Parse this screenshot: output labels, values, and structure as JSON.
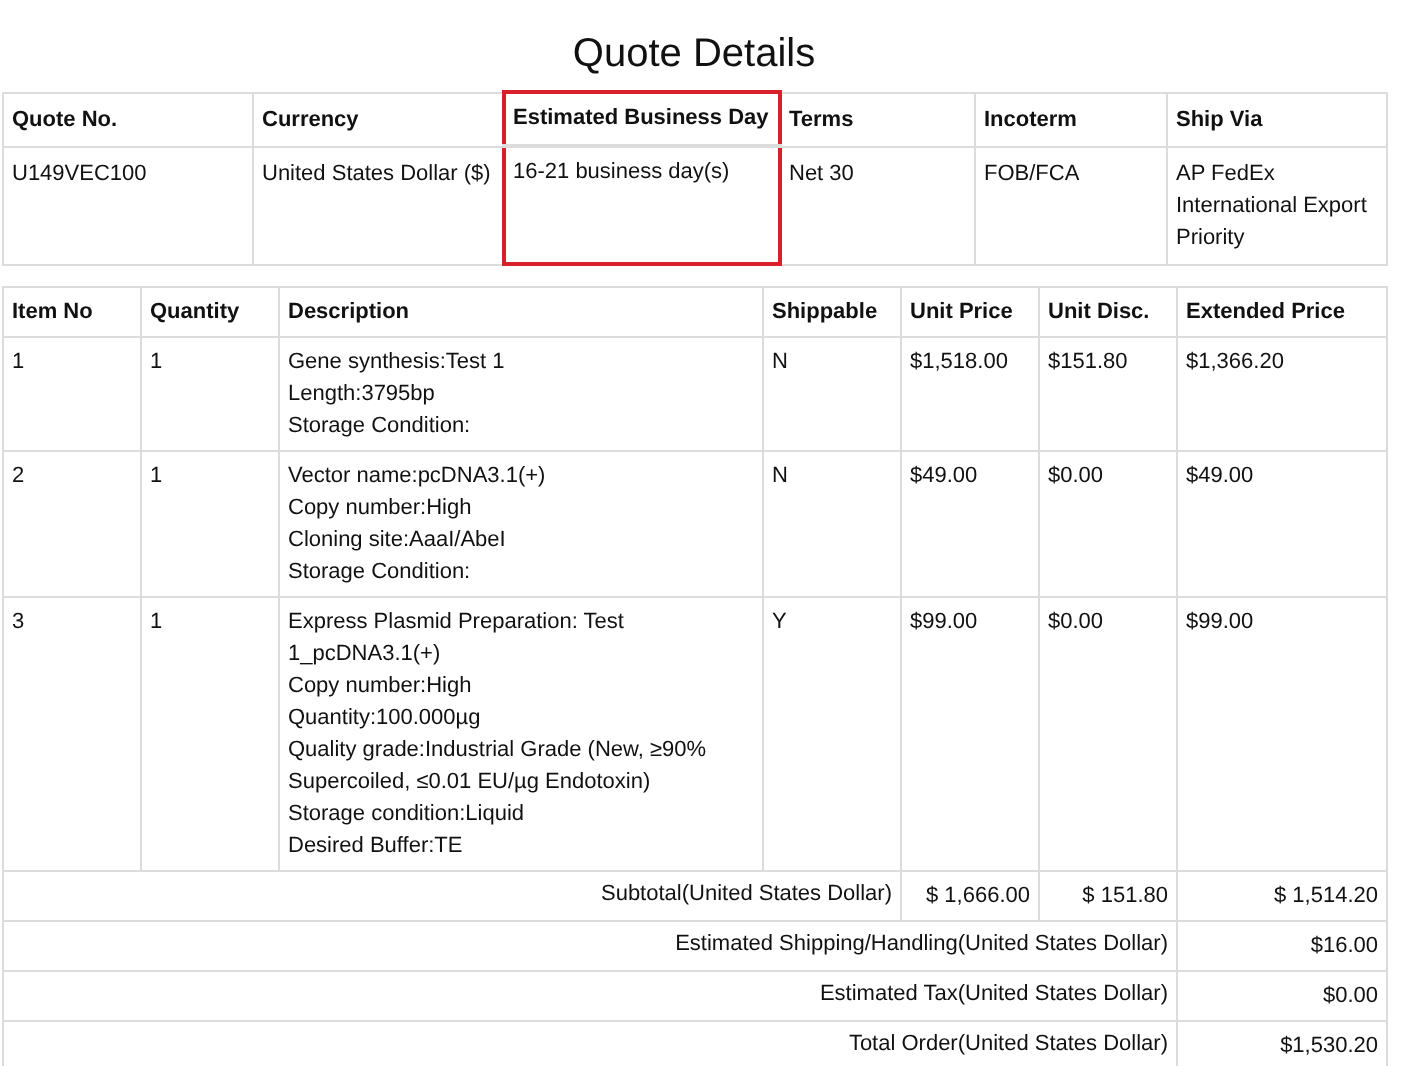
{
  "title": "Quote Details",
  "quote": {
    "columns": [
      {
        "label": "Quote No.",
        "value": "U149VEC100",
        "highlighted": false
      },
      {
        "label": "Currency",
        "value": "United States Dollar ($)",
        "highlighted": false
      },
      {
        "label": "Estimated Business Day",
        "value": "16-21 business day(s)",
        "highlighted": true
      },
      {
        "label": "Terms",
        "value": "Net 30",
        "highlighted": false
      },
      {
        "label": "Incoterm",
        "value": "FOB/FCA",
        "highlighted": false
      },
      {
        "label": "Ship Via",
        "value": "AP FedEx International Export Priority",
        "highlighted": false
      }
    ]
  },
  "items": {
    "columns": [
      "Item No",
      "Quantity",
      "Description",
      "Shippable",
      "Unit Price",
      "Unit Disc.",
      "Extended Price"
    ],
    "rows": [
      {
        "item_no": "1",
        "quantity": "1",
        "description": [
          "Gene synthesis:Test 1",
          "Length:3795bp",
          "Storage Condition:"
        ],
        "shippable": "N",
        "unit_price": "$1,518.00",
        "unit_disc": "$151.80",
        "extended_price": "$1,366.20"
      },
      {
        "item_no": "2",
        "quantity": "1",
        "description": [
          "Vector name:pcDNA3.1(+)",
          "Copy number:High",
          "Cloning site:AaaI/AbeI",
          "Storage Condition:"
        ],
        "shippable": "N",
        "unit_price": "$49.00",
        "unit_disc": "$0.00",
        "extended_price": "$49.00"
      },
      {
        "item_no": "3",
        "quantity": "1",
        "description": [
          "Express Plasmid Preparation: Test 1_pcDNA3.1(+)",
          "Copy number:High",
          "Quantity:100.000µg",
          "Quality grade:Industrial Grade (New, ≥90% Supercoiled, ≤0.01 EU/µg Endotoxin)",
          "Storage condition:Liquid",
          "Desired Buffer:TE"
        ],
        "shippable": "Y",
        "unit_price": "$99.00",
        "unit_disc": "$0.00",
        "extended_price": "$99.00"
      }
    ],
    "subtotal": {
      "label": "Subtotal(United States Dollar)",
      "unit_price": "$ 1,666.00",
      "unit_disc": "$ 151.80",
      "extended_price": "$ 1,514.20"
    },
    "totals": [
      {
        "label": "Estimated Shipping/Handling(United States Dollar)",
        "value": "$16.00"
      },
      {
        "label": "Estimated Tax(United States Dollar)",
        "value": "$0.00"
      },
      {
        "label": "Total Order(United States Dollar)",
        "value": "$1,530.20"
      }
    ]
  }
}
